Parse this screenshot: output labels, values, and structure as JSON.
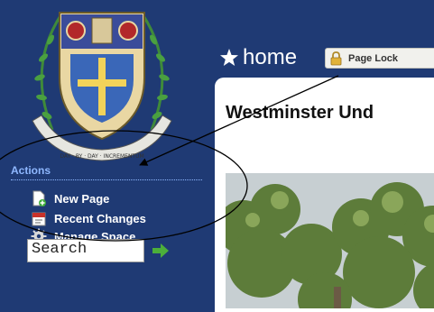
{
  "crest": {
    "motto": "DAY · BY · DAY · INCREMENTUM"
  },
  "sidebar": {
    "actions_heading": "Actions",
    "items": [
      {
        "label": "New Page",
        "icon": "new-page-icon"
      },
      {
        "label": "Recent Changes",
        "icon": "recent-changes-icon"
      },
      {
        "label": "Manage Space",
        "icon": "gear-icon"
      }
    ],
    "search": {
      "value": "Search"
    }
  },
  "header": {
    "home_label": "home",
    "page_lock_label": "Page Lock"
  },
  "content": {
    "title": "Westminster Und"
  },
  "colors": {
    "background": "#1f3a74",
    "accent": "#8fb8ff",
    "go_arrow": "#4caf3a"
  }
}
